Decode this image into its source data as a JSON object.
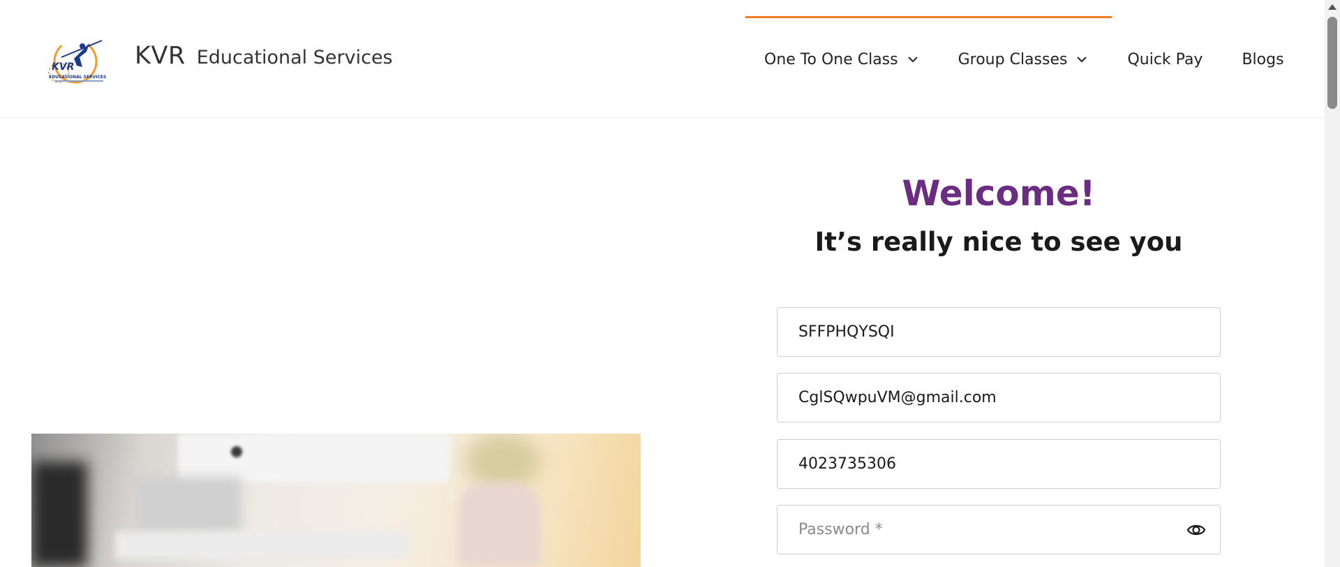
{
  "header": {
    "brand_name": "KVR",
    "brand_sub": "Educational Services",
    "logo_icon": "kvr-logo",
    "accent_color": "#f47b20",
    "nav": [
      {
        "label": "One To One Class",
        "has_dropdown": true
      },
      {
        "label": "Group Classes",
        "has_dropdown": true
      },
      {
        "label": "Quick Pay",
        "has_dropdown": false
      },
      {
        "label": "Blogs",
        "has_dropdown": false
      }
    ]
  },
  "form": {
    "title": "Welcome!",
    "subtitle": "It’s really nice to see you",
    "title_color": "#6b2d82",
    "fields": [
      {
        "value": "SFFPHQYSQI",
        "placeholder": ""
      },
      {
        "value": "CglSQwpuVM@gmail.com",
        "placeholder": ""
      },
      {
        "value": "4023735306",
        "placeholder": ""
      },
      {
        "value": "",
        "placeholder": "Password *",
        "icon": "eye-icon"
      }
    ]
  }
}
